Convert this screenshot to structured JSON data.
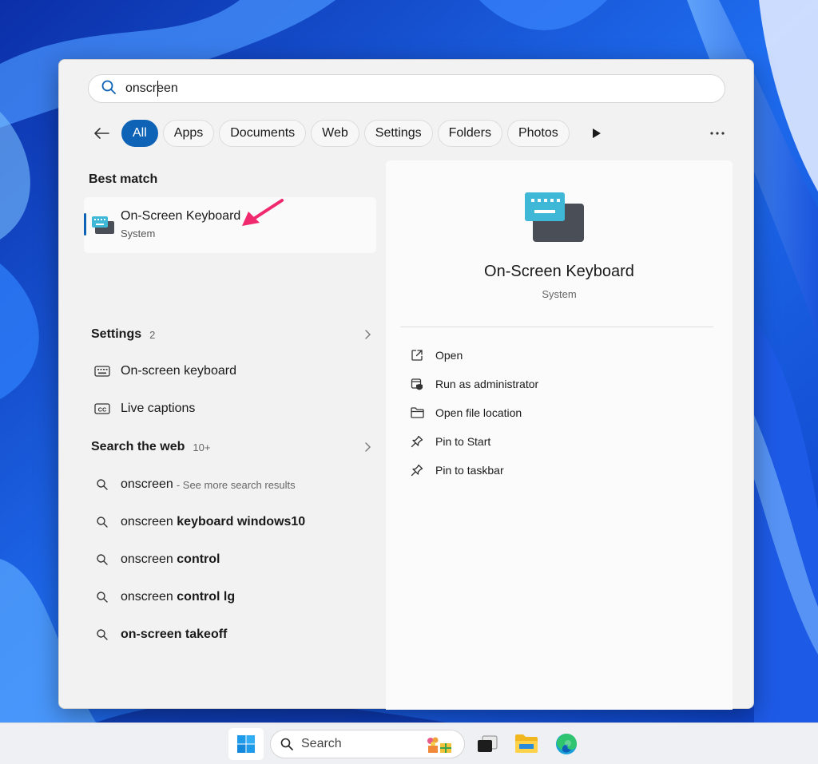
{
  "search": {
    "query": "onscreen"
  },
  "filters": {
    "tabs": [
      {
        "label": "All",
        "active": true
      },
      {
        "label": "Apps"
      },
      {
        "label": "Documents"
      },
      {
        "label": "Web"
      },
      {
        "label": "Settings"
      },
      {
        "label": "Folders"
      },
      {
        "label": "Photos"
      }
    ]
  },
  "best_match": {
    "title": "Best match",
    "name": "On-Screen Keyboard",
    "type": "System"
  },
  "settings_group": {
    "title": "Settings",
    "count": "2",
    "items": [
      {
        "label": "On-screen keyboard",
        "icon": "keyboard-icon"
      },
      {
        "label": "Live captions",
        "icon": "captions-icon"
      }
    ]
  },
  "web_group": {
    "title": "Search the web",
    "count": "10+",
    "items": [
      {
        "plain": "onscreen",
        "bold": "",
        "hint": "- See more search results"
      },
      {
        "plain": "onscreen ",
        "bold": "keyboard windows10",
        "hint": ""
      },
      {
        "plain": "onscreen ",
        "bold": "control",
        "hint": ""
      },
      {
        "plain": "onscreen ",
        "bold": "control lg",
        "hint": ""
      },
      {
        "plain": "",
        "bold": "on-screen takeoff",
        "hint": ""
      }
    ]
  },
  "detail": {
    "name": "On-Screen Keyboard",
    "type": "System",
    "actions": [
      {
        "label": "Open",
        "icon": "open-external-icon"
      },
      {
        "label": "Run as administrator",
        "icon": "shield-icon"
      },
      {
        "label": "Open file location",
        "icon": "folder-icon"
      },
      {
        "label": "Pin to Start",
        "icon": "pin-icon"
      },
      {
        "label": "Pin to taskbar",
        "icon": "pin-icon"
      }
    ]
  },
  "taskbar": {
    "search_label": "Search",
    "apps": [
      "windows-start-icon",
      "task-view-icon",
      "file-explorer-icon",
      "edge-icon"
    ]
  },
  "colors": {
    "accent": "#0f63b6",
    "annotation_arrow": "#f0286e"
  }
}
